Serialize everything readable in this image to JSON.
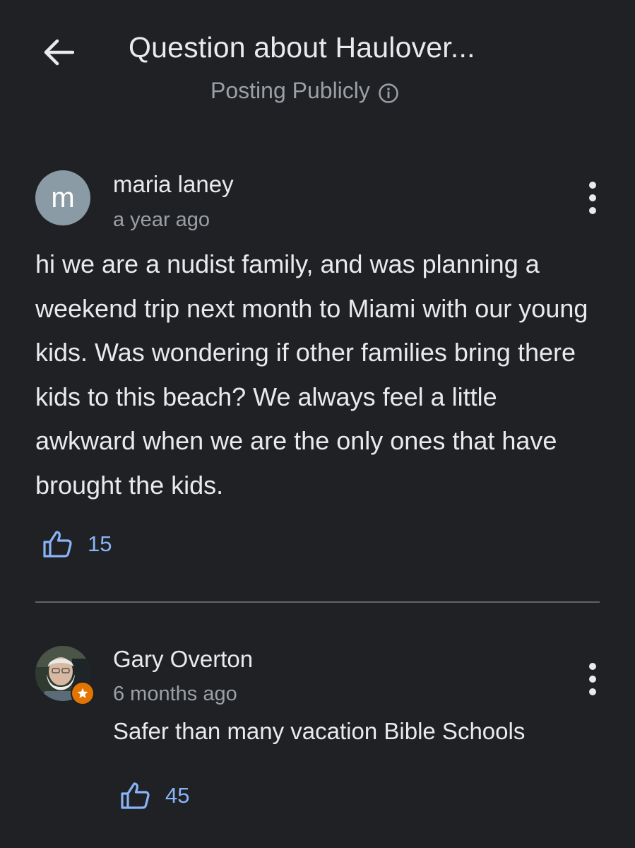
{
  "header": {
    "back_icon": "arrow-back-icon",
    "title": "Question about Haulover...",
    "subtitle": "Posting Publicly",
    "info_icon": "info-icon"
  },
  "question": {
    "avatar_letter": "m",
    "author": "maria laney",
    "time": "a year ago",
    "text": "hi we are a nudist family, and was planning a weekend trip next month to Miami with our young kids. Was wondering if other families bring there kids to this beach? We always feel a little awkward when we are the only ones that have brought the kids.",
    "likes": "15",
    "more_icon": "more-vert-icon"
  },
  "reply": {
    "author": "Gary Overton",
    "time": "6 months ago",
    "text": "Safer than many vacation Bible Schools",
    "likes": "45",
    "badge_icon": "local-guide-star-icon",
    "more_icon": "more-vert-icon"
  },
  "colors": {
    "background": "#202124",
    "text": "#e8eaed",
    "secondary_text": "#9aa0a6",
    "accent": "#8ab4f8",
    "avatar_bg": "#8a9ba6",
    "badge": "#e37400"
  }
}
